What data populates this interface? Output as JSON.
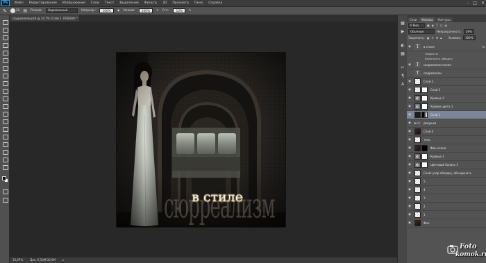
{
  "app": {
    "logo": "Ps",
    "menu": [
      "Файл",
      "Редактирование",
      "Изображение",
      "Слои",
      "Текст",
      "Выделение",
      "Фильтр",
      "3D",
      "Просмотр",
      "Окно",
      "Справка"
    ],
    "window_controls": [
      "–",
      "□",
      "✕"
    ]
  },
  "options": {
    "brush_size": "20",
    "mode_label": "Режим:",
    "mode_value": "Нормальный",
    "opacity_label": "Непрозр.:",
    "opacity_value": "100%",
    "flow_label": "Нажим:",
    "flow_value": "100%",
    "smooth_label": "Сгл.:",
    "smooth_value": "10%"
  },
  "document": {
    "tab_title": "сюрреализм.psd @ 14,7% (Слой 1, RGB/8#) *",
    "zoom": "16,67%",
    "doc_info": "Док: 6,50М/30,9М"
  },
  "artwork": {
    "watermark_big": "сюрреализм",
    "headline": "в стиле"
  },
  "panels": {
    "tabs": [
      "Слои",
      "Каналы",
      "Контуры"
    ],
    "active_tab": "Слои",
    "kind_label": "Р Вид",
    "blend_mode": "Обычные",
    "opacity_label": "Непрозрачность:",
    "opacity_value": "29%",
    "lock_label": "Закрепить:",
    "fill_label": "Заливка:",
    "fill_value": "100%"
  },
  "layers": [
    {
      "name": "в стиле",
      "thumb": "text",
      "visible": true,
      "fx": true
    },
    {
      "name": "Эффекты",
      "sub": true
    },
    {
      "name": "Выполнить обводку",
      "sub": true
    },
    {
      "name": "сюрреализм копия",
      "thumb": "text",
      "visible": true
    },
    {
      "name": "сюрреализм",
      "thumb": "text",
      "visible": false
    },
    {
      "name": "Слой 2",
      "thumb": "checker",
      "visible": true
    },
    {
      "name": "Слой 3",
      "thumb": "checker",
      "mask": "white",
      "visible": true
    },
    {
      "name": "Кривые 2",
      "thumb": "adj",
      "mask": "white",
      "visible": true
    },
    {
      "name": "Уровни цвета 1",
      "thumb": "adj",
      "mask": "white",
      "visible": true
    },
    {
      "name": "Слой 1",
      "thumb": "dark",
      "mask": "grad",
      "visible": true,
      "selected": true
    },
    {
      "name": "девушка",
      "thumb": "folder",
      "visible": true
    },
    {
      "name": "Слой 4",
      "thumb": "photo",
      "visible": true
    },
    {
      "name": "тень",
      "thumb": "checker",
      "visible": true
    },
    {
      "name": "Фон копия",
      "thumb": "photo",
      "mask": "black",
      "visible": true
    },
    {
      "name": "Кривые 1",
      "thumb": "adj",
      "mask": "white",
      "visible": true
    },
    {
      "name": "Цветовой баланс 1",
      "thumb": "adj",
      "mask": "white",
      "visible": true
    },
    {
      "name": "Слой: узор обводку, объединить",
      "thumb": "checker",
      "visible": true
    },
    {
      "name": "5",
      "thumb": "checker",
      "visible": true
    },
    {
      "name": "4",
      "thumb": "checker",
      "visible": true
    },
    {
      "name": "3",
      "thumb": "checker",
      "visible": true
    },
    {
      "name": "2",
      "thumb": "checker",
      "visible": true
    },
    {
      "name": "1",
      "thumb": "checker",
      "visible": true
    },
    {
      "name": "Фон",
      "thumb": "photo",
      "visible": true
    }
  ],
  "watermark": {
    "line1": "Foto",
    "line2": "komok.ru"
  }
}
